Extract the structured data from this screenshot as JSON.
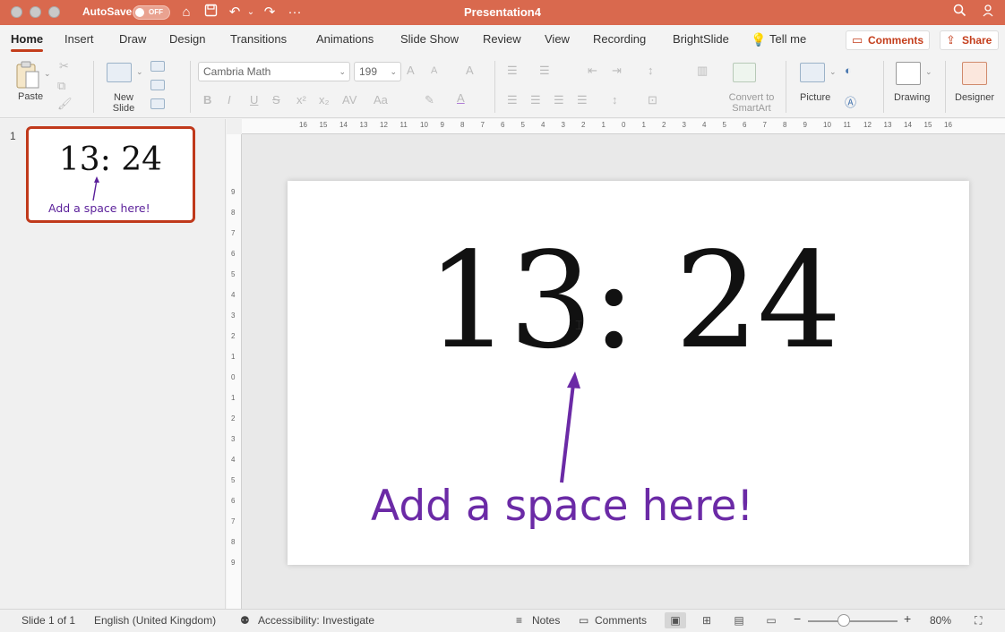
{
  "app": {
    "title": "Presentation4",
    "autosave_label": "AutoSave",
    "autosave_state": "OFF"
  },
  "tabs": [
    "Home",
    "Insert",
    "Draw",
    "Design",
    "Transitions",
    "Animations",
    "Slide Show",
    "Review",
    "View",
    "Recording",
    "BrightSlide"
  ],
  "active_tab": "Home",
  "tell_me": "Tell me",
  "comments_button": "Comments",
  "share_button": "Share",
  "ribbon": {
    "paste": "Paste",
    "new_slide": "New Slide",
    "font_name": "Cambria Math",
    "font_size": "199",
    "convert_smartart": "Convert to SmartArt",
    "picture": "Picture",
    "drawing": "Drawing",
    "designer": "Designer"
  },
  "thumbnail": {
    "number": "1",
    "time": "13: 24",
    "note": "Add a space here!"
  },
  "ruler_h": [
    "16",
    "15",
    "14",
    "13",
    "12",
    "11",
    "10",
    "9",
    "8",
    "7",
    "6",
    "5",
    "4",
    "3",
    "2",
    "1",
    "0",
    "1",
    "2",
    "3",
    "4",
    "5",
    "6",
    "7",
    "8",
    "9",
    "10",
    "11",
    "12",
    "13",
    "14",
    "15",
    "16"
  ],
  "ruler_v": [
    "9",
    "8",
    "7",
    "6",
    "5",
    "4",
    "3",
    "2",
    "1",
    "0",
    "1",
    "2",
    "3",
    "4",
    "5",
    "6",
    "7",
    "8",
    "9"
  ],
  "slide": {
    "time": "13: 24",
    "note": "Add a space here!",
    "note_color": "#6b2aa6"
  },
  "status": {
    "slide_of": "Slide 1 of 1",
    "language": "English (United Kingdom)",
    "accessibility": "Accessibility: Investigate",
    "notes": "Notes",
    "comments": "Comments",
    "zoom": "80%"
  },
  "colors": {
    "titlebar": "#d9694e",
    "accent": "#c43e1c"
  }
}
